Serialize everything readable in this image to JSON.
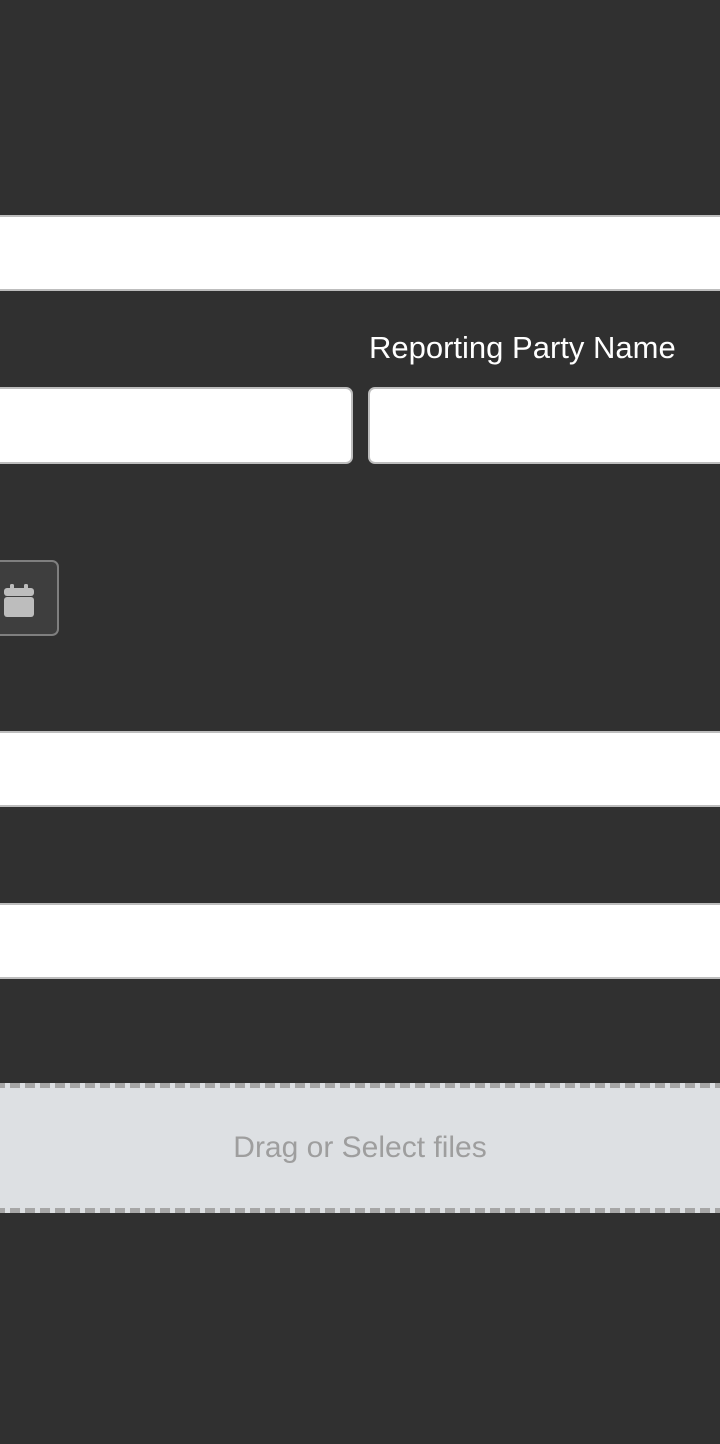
{
  "form": {
    "reporting_party": {
      "label": "Reporting Party Name",
      "value": ""
    },
    "left_field": {
      "value": ""
    },
    "text_field_1": {
      "value": ""
    },
    "text_field_2": {
      "value": ""
    },
    "text_field_3": {
      "value": ""
    },
    "date_picker": {
      "icon": "calendar-icon"
    },
    "upload": {
      "label": "Drag or Select files"
    }
  },
  "colors": {
    "background": "#303030",
    "input_background": "#ffffff",
    "input_border": "#bdbdbd",
    "dropzone_background": "#dde0e3",
    "dropzone_border": "#a6a6a6",
    "dropzone_text": "#9e9e9e",
    "icon": "#bdbdbd"
  }
}
